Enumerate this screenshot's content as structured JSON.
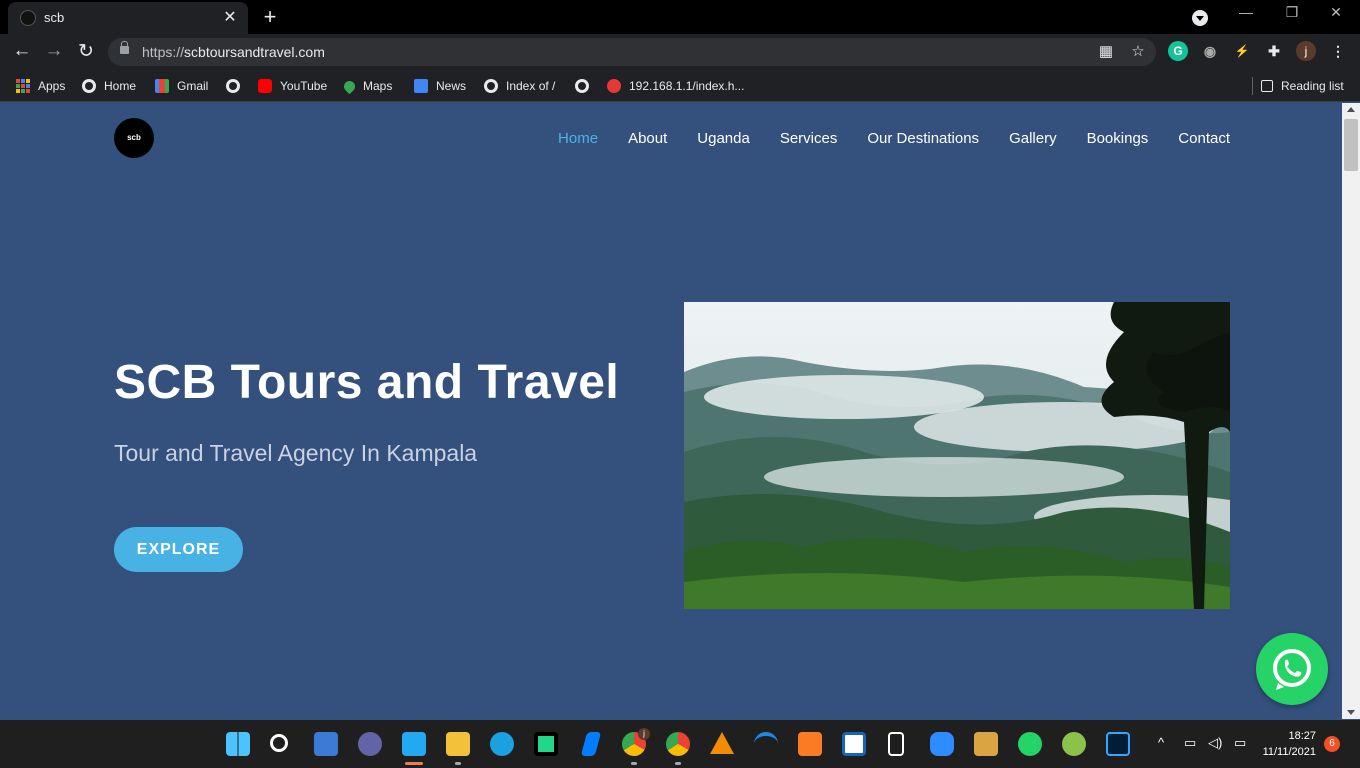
{
  "browser": {
    "tab_title": "scb",
    "url_scheme": "https://",
    "url_host": "scbtoursandtravel.com",
    "bookmarks": [
      {
        "label": "Apps",
        "icon": "apps-grid-icon"
      },
      {
        "label": "Home",
        "icon": "globe-icon"
      },
      {
        "label": "Gmail",
        "icon": "gmail-icon"
      },
      {
        "label": "",
        "icon": "globe-icon"
      },
      {
        "label": "YouTube",
        "icon": "youtube-icon"
      },
      {
        "label": "Maps",
        "icon": "maps-icon"
      },
      {
        "label": "News",
        "icon": "news-icon"
      },
      {
        "label": "Index of /",
        "icon": "globe-icon"
      },
      {
        "label": "",
        "icon": "globe-icon"
      },
      {
        "label": "192.168.1.1/index.h...",
        "icon": "router-icon"
      }
    ],
    "reading_list": "Reading list",
    "profile_initial": "j"
  },
  "site": {
    "logo_text": "scb",
    "nav": [
      "Home",
      "About",
      "Uganda",
      "Services",
      "Our Destinations",
      "Gallery",
      "Bookings",
      "Contact"
    ],
    "active_nav": "Home",
    "accent_color": "#4bb3e6",
    "background_color": "#34507d",
    "hero": {
      "title": "SCB Tours and Travel",
      "subtitle": "Tour and Travel Agency In Kampala",
      "button": "EXPLORE"
    }
  },
  "taskbar": {
    "time": "18:27",
    "date": "11/11/2021",
    "notifications": "6",
    "chrome_badge": "j"
  }
}
